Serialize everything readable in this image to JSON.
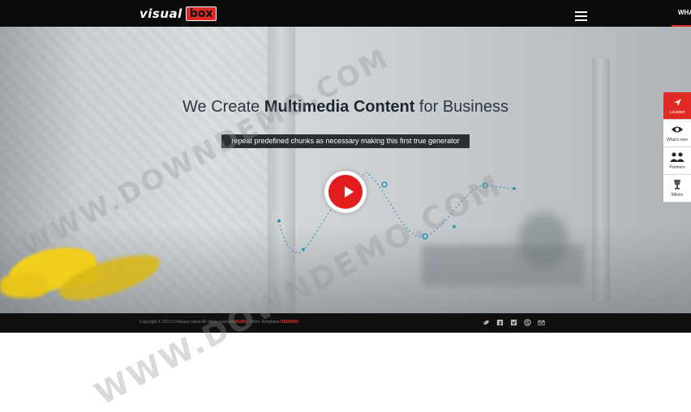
{
  "brand": {
    "logo_word": "visual",
    "logo_box": "box"
  },
  "nav": {
    "top_link": "WHA"
  },
  "hero": {
    "headline_pre": "We Create ",
    "headline_bold": "Multimedia Content",
    "headline_post": " for Business",
    "subline": "repeat predefined chunks as necessary making this first true generator"
  },
  "side_menu": [
    {
      "label": "Location",
      "icon": "location-arrow-icon"
    },
    {
      "label": "What's new",
      "icon": "eye-icon"
    },
    {
      "label": "Partners",
      "icon": "users-icon"
    },
    {
      "label": "Milans",
      "icon": "trophy-icon"
    }
  ],
  "footer": {
    "copyright": "Copyright © 2013 Company name All rights reserved",
    "red_1": "BOBS",
    "middle": " - More Templates ",
    "red_2": "REMAND"
  },
  "social": [
    "twitter-icon",
    "facebook-icon",
    "vimeo-icon",
    "skype-icon",
    "mail-icon"
  ],
  "watermark": "WWW.DOWNDEMO.COM",
  "colors": {
    "accent": "#e02a26",
    "topbar": "#0b0b0b",
    "play_red": "#e11d1d"
  }
}
